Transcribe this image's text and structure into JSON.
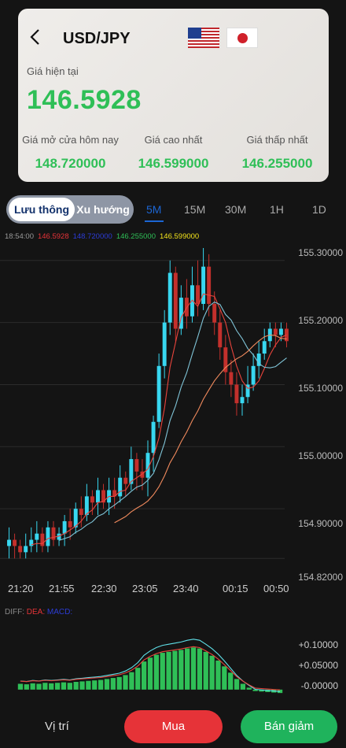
{
  "header": {
    "pair": "USD/JPY",
    "current_label": "Giá hiện tại",
    "current_price": "146.5928"
  },
  "stats": [
    {
      "label": "Giá mở cửa hôm nay",
      "value": "148.720000"
    },
    {
      "label": "Giá cao nhất",
      "value": "146.599000"
    },
    {
      "label": "Giá thấp nhất",
      "value": "146.255000"
    }
  ],
  "mode_toggle": {
    "active": "Lưu thông",
    "inactive": "Xu hướng"
  },
  "timeframes": [
    "5M",
    "15M",
    "30M",
    "1H",
    "1D"
  ],
  "selected_timeframe": "5M",
  "legend": {
    "time": "18:54:00",
    "close": "146.5928",
    "open": "148.720000",
    "low": "146.255000",
    "high": "146.599000"
  },
  "y_ticks": [
    "155.30000",
    "155.20000",
    "155.10000",
    "155.00000",
    "154.90000",
    "154.82000"
  ],
  "x_ticks": [
    "21:20",
    "21:55",
    "22:30",
    "23:05",
    "23:40",
    "00:15",
    "00:50"
  ],
  "macd_legend": {
    "diff": "DIFF:",
    "dea": "DEA:",
    "macd": "MACD:"
  },
  "macd_y_ticks": [
    "+0.10000",
    "+0.05000",
    "-0.00000"
  ],
  "actions": {
    "position": "Vị trí",
    "buy": "Mua",
    "sell": "Bán giảm"
  },
  "colors": {
    "up": "#2fbf57",
    "down": "#e63338",
    "accent": "#1c66d4",
    "candle_up": "#38d7f0",
    "candle_down": "#c3302c"
  },
  "chart_data": [
    {
      "type": "candlestick",
      "x_tick_labels": [
        "21:20",
        "21:55",
        "22:30",
        "23:05",
        "23:40",
        "00:15",
        "00:50"
      ],
      "ylim": [
        154.8,
        155.32
      ],
      "candles": [
        [
          154.84,
          154.85,
          154.82,
          154.87
        ],
        [
          154.85,
          154.84,
          154.82,
          154.86
        ],
        [
          154.84,
          154.83,
          154.82,
          154.85
        ],
        [
          154.83,
          154.84,
          154.82,
          154.86
        ],
        [
          154.84,
          154.85,
          154.83,
          154.87
        ],
        [
          154.85,
          154.86,
          154.83,
          154.88
        ],
        [
          154.86,
          154.84,
          154.83,
          154.87
        ],
        [
          154.84,
          154.87,
          154.83,
          154.88
        ],
        [
          154.87,
          154.85,
          154.84,
          154.88
        ],
        [
          154.85,
          154.86,
          154.84,
          154.87
        ],
        [
          154.86,
          154.88,
          154.84,
          154.89
        ],
        [
          154.88,
          154.87,
          154.85,
          154.9
        ],
        [
          154.87,
          154.9,
          154.86,
          154.91
        ],
        [
          154.9,
          154.89,
          154.87,
          154.92
        ],
        [
          154.89,
          154.92,
          154.88,
          154.94
        ],
        [
          154.92,
          154.91,
          154.89,
          154.93
        ],
        [
          154.91,
          154.93,
          154.89,
          154.95
        ],
        [
          154.93,
          154.91,
          154.9,
          154.94
        ],
        [
          154.91,
          154.93,
          154.89,
          154.95
        ],
        [
          154.93,
          154.92,
          154.9,
          154.95
        ],
        [
          154.92,
          154.95,
          154.91,
          154.97
        ],
        [
          154.95,
          154.94,
          154.92,
          154.96
        ],
        [
          154.94,
          154.98,
          154.93,
          155.0
        ],
        [
          154.98,
          154.96,
          154.93,
          154.99
        ],
        [
          154.96,
          154.95,
          154.93,
          154.98
        ],
        [
          154.95,
          154.99,
          154.92,
          155.01
        ],
        [
          154.99,
          155.04,
          154.96,
          155.05
        ],
        [
          155.04,
          155.13,
          155.03,
          155.15
        ],
        [
          155.13,
          155.2,
          155.11,
          155.22
        ],
        [
          155.2,
          155.28,
          155.18,
          155.3
        ],
        [
          155.28,
          155.19,
          155.17,
          155.29
        ],
        [
          155.19,
          155.24,
          155.18,
          155.26
        ],
        [
          155.24,
          155.21,
          155.19,
          155.27
        ],
        [
          155.21,
          155.26,
          155.2,
          155.29
        ],
        [
          155.26,
          155.23,
          155.21,
          155.3
        ],
        [
          155.23,
          155.29,
          155.22,
          155.32
        ],
        [
          155.29,
          155.23,
          155.21,
          155.31
        ],
        [
          155.23,
          155.2,
          155.18,
          155.25
        ],
        [
          155.2,
          155.16,
          155.14,
          155.22
        ],
        [
          155.16,
          155.12,
          155.1,
          155.18
        ],
        [
          155.12,
          155.1,
          155.08,
          155.14
        ],
        [
          155.1,
          155.07,
          155.05,
          155.12
        ],
        [
          155.07,
          155.08,
          155.05,
          155.1
        ],
        [
          155.08,
          155.1,
          155.07,
          155.13
        ],
        [
          155.1,
          155.13,
          155.09,
          155.15
        ],
        [
          155.13,
          155.15,
          155.11,
          155.17
        ],
        [
          155.15,
          155.17,
          155.14,
          155.19
        ],
        [
          155.17,
          155.19,
          155.16,
          155.2
        ],
        [
          155.19,
          155.18,
          155.16,
          155.2
        ],
        [
          155.18,
          155.19,
          155.17,
          155.2
        ],
        [
          155.19,
          155.17,
          155.16,
          155.2
        ]
      ],
      "candle_order": "open, close, low, high"
    },
    {
      "type": "bar",
      "name": "MACD",
      "ylim": [
        -0.01,
        0.12
      ],
      "values": [
        0.012,
        0.011,
        0.013,
        0.012,
        0.014,
        0.013,
        0.014,
        0.015,
        0.014,
        0.016,
        0.017,
        0.018,
        0.019,
        0.02,
        0.022,
        0.024,
        0.026,
        0.03,
        0.036,
        0.045,
        0.058,
        0.066,
        0.072,
        0.076,
        0.078,
        0.08,
        0.082,
        0.085,
        0.087,
        0.085,
        0.078,
        0.07,
        0.06,
        0.048,
        0.035,
        0.022,
        0.012,
        0.004,
        -0.003,
        -0.004,
        -0.005,
        -0.006,
        -0.007
      ]
    }
  ]
}
